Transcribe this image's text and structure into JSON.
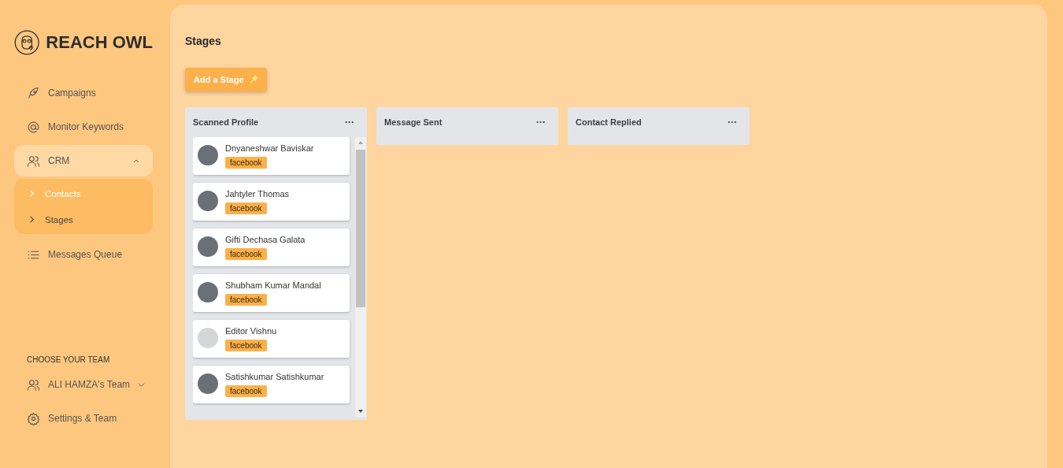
{
  "brand": {
    "name": "REACH OWL"
  },
  "nav": [
    {
      "kind": "link",
      "label": "Campaigns"
    },
    {
      "kind": "link",
      "label": "Monitor Keywords"
    },
    {
      "kind": "group",
      "label": "CRM",
      "expanded": true,
      "children": [
        {
          "label": "Contacts",
          "selected": true
        },
        {
          "label": "Stages",
          "selected": false
        }
      ]
    },
    {
      "kind": "link",
      "label": "Messages Queue"
    }
  ],
  "team": {
    "heading": "CHOOSE YOUR TEAM",
    "name": "ALI HAMZA's Team",
    "settings": "Settings & Team"
  },
  "page": {
    "title": "Stages",
    "add_button": "Add a Stage"
  },
  "stages": [
    {
      "title": "Scanned Profile",
      "menu": "···",
      "contacts": [
        {
          "name": "Dnyaneshwar Baviskar",
          "tag": "facebook",
          "photo": true
        },
        {
          "name": "Jahtyler Thomas",
          "tag": "facebook",
          "photo": true
        },
        {
          "name": "Gifti Dechasa Galata",
          "tag": "facebook",
          "photo": true
        },
        {
          "name": "Shubham Kumar Mandal",
          "tag": "facebook",
          "photo": true
        },
        {
          "name": "Editor Vishnu",
          "tag": "facebook",
          "photo": false
        },
        {
          "name": "Satishkumar Satishkumar",
          "tag": "facebook",
          "photo": true
        }
      ]
    },
    {
      "title": "Message Sent",
      "menu": "···"
    },
    {
      "title": "Contact Replied",
      "menu": "···"
    }
  ]
}
